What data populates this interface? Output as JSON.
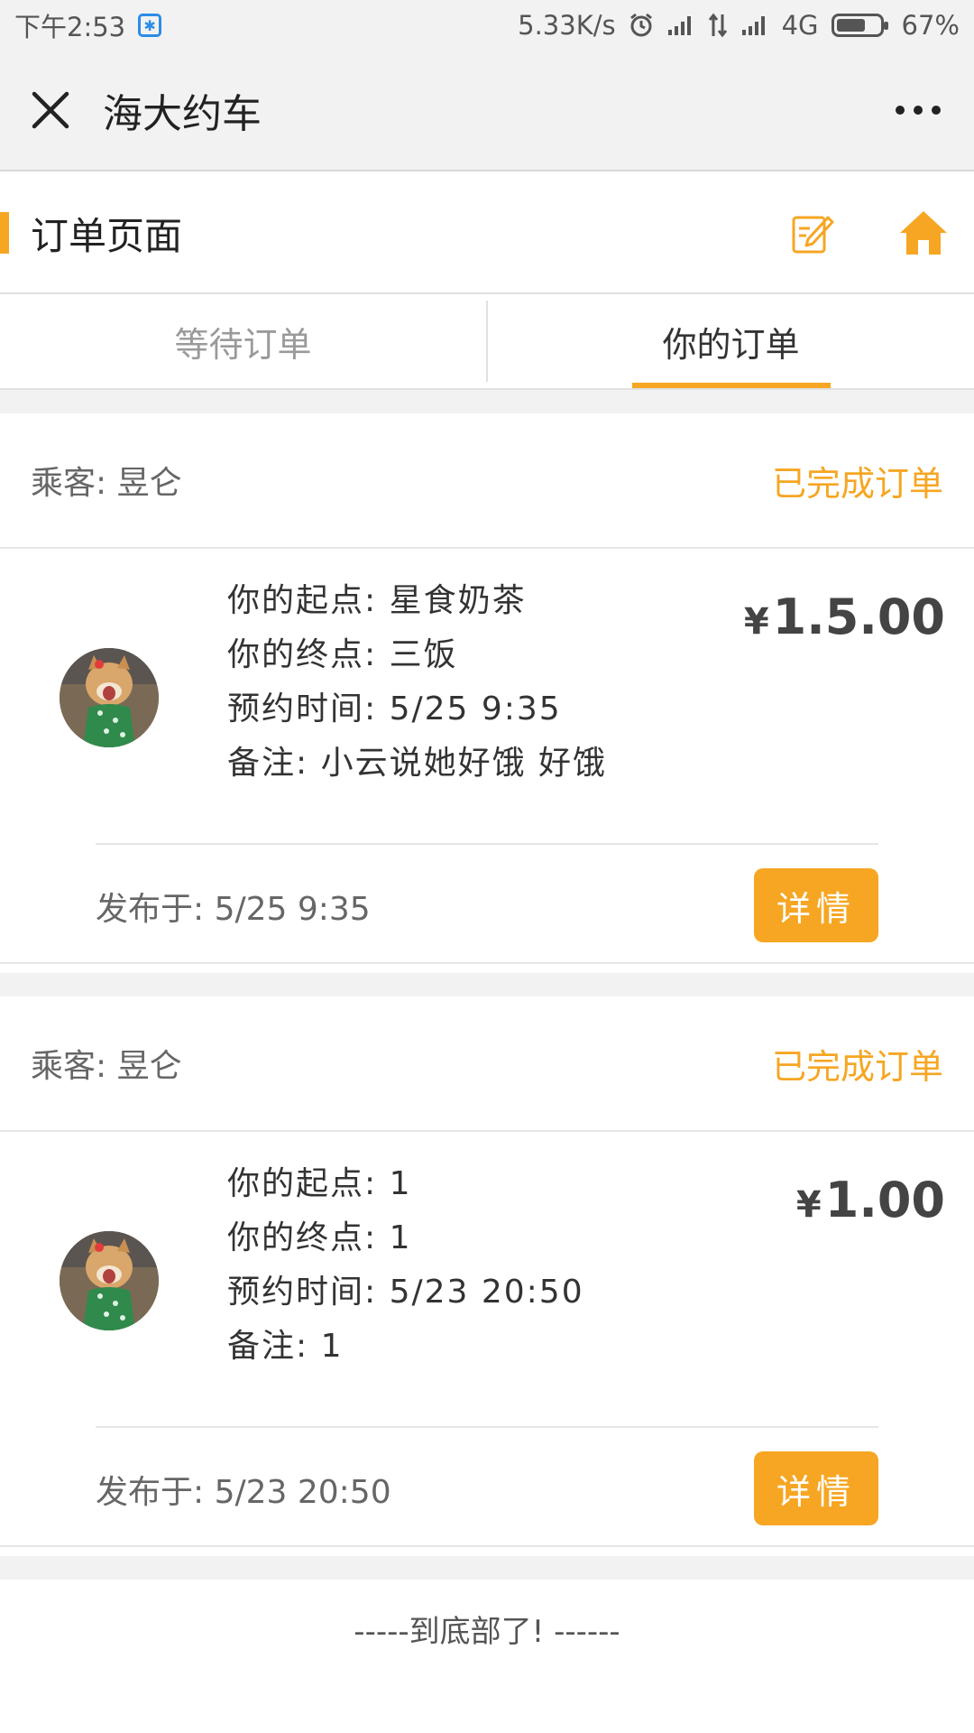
{
  "status_bar": {
    "time": "下午2:53",
    "speed": "5.33K/s",
    "network": "4G",
    "battery": "67%",
    "battery_level": 0.67
  },
  "nav": {
    "title": "海大约车"
  },
  "header": {
    "title": "订单页面",
    "accent_color": "#f6a623"
  },
  "tabs": [
    {
      "label": "等待订单",
      "active": false
    },
    {
      "label": "你的订单",
      "active": true
    }
  ],
  "orders": [
    {
      "passenger": "乘客: 昱仑",
      "status": "已完成订单",
      "start": "你的起点: 星食奶茶",
      "end": "你的终点: 三饭",
      "time": "预约时间: 5/25 9:35",
      "note": "备注: 小云说她好饿 好饿",
      "price": "1.5.00",
      "currency": "¥",
      "posted": "发布于: 5/25 9:35",
      "detail_label": "详情"
    },
    {
      "passenger": "乘客: 昱仑",
      "status": "已完成订单",
      "start": "你的起点: 1",
      "end": "你的终点: 1",
      "time": "预约时间: 5/23 20:50",
      "note": "备注: 1",
      "price": "1.00",
      "currency": "¥",
      "posted": "发布于: 5/23 20:50",
      "detail_label": "详情"
    }
  ],
  "footer": {
    "end_text": "-----到底部了! ------"
  },
  "icons": {
    "close": "close-icon",
    "more": "more-icon",
    "edit": "edit-icon",
    "home": "home-icon",
    "avatar": "dog-avatar"
  }
}
